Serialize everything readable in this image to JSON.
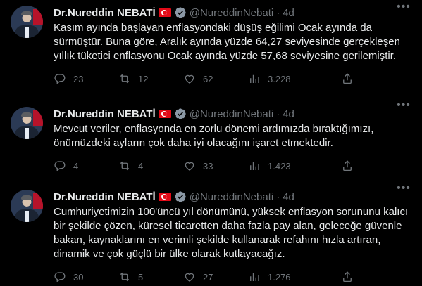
{
  "tweets": [
    {
      "author_name": "Dr.Nureddin NEBATİ",
      "handle": "@NureddinNebati",
      "separator": "·",
      "time": "4d",
      "text": "Kasım ayında başlayan enflasyondaki düşüş eğilimi Ocak ayında da sürmüştür. Buna göre, Aralık ayında yüzde 64,27 seviyesinde gerçekleşen yıllık tüketici enflasyonu Ocak ayında yüzde 57,68 seviyesine gerilemiştir.",
      "replies": "23",
      "retweets": "12",
      "likes": "62",
      "views": "3.228"
    },
    {
      "author_name": "Dr.Nureddin NEBATİ",
      "handle": "@NureddinNebati",
      "separator": "·",
      "time": "4d",
      "text": "Mevcut veriler, enflasyonda en zorlu dönemi ardımızda bıraktığımızı, önümüzdeki ayların çok daha iyi olacağını işaret etmektedir.",
      "replies": "4",
      "retweets": "4",
      "likes": "33",
      "views": "1.423"
    },
    {
      "author_name": "Dr.Nureddin NEBATİ",
      "handle": "@NureddinNebati",
      "separator": "·",
      "time": "4d",
      "text": "Cumhuriyetimizin 100'üncü yıl dönümünü, yüksek enflasyon sorununu kalıcı bir şekilde çözen, küresel ticaretten daha fazla pay alan, geleceğe güvenle bakan, kaynaklarını en verimli şekilde kullanarak refahını hızla artıran, dinamik ve çok güçlü bir ülke olarak kutlayacağız.",
      "replies": "30",
      "retweets": "5",
      "likes": "27",
      "views": "1.276"
    }
  ],
  "colors": {
    "background": "#000000",
    "text": "#e7e9ea",
    "muted": "#71767b",
    "verified_badge": "#8b98a5",
    "divider": "#2f3336",
    "turkish_flag": "#e30a17"
  },
  "icons": {
    "reply": "reply-icon",
    "retweet": "retweet-icon",
    "like": "heart-icon",
    "views": "views-icon",
    "share": "share-icon",
    "more": "more-icon",
    "verified": "verified-badge-icon"
  }
}
